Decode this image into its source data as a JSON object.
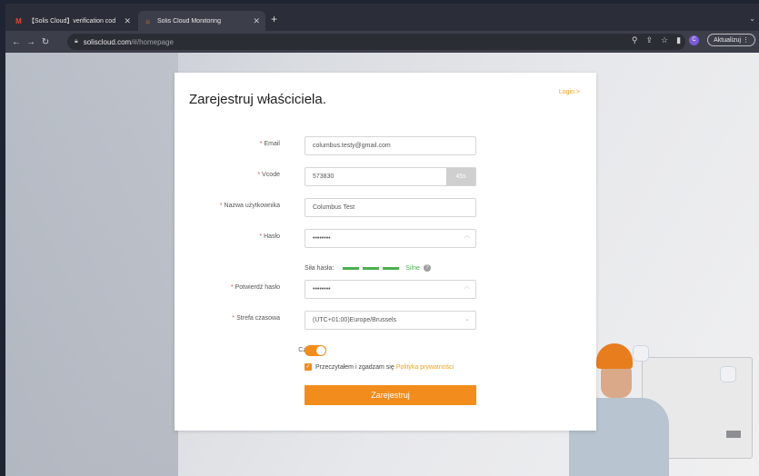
{
  "browser": {
    "tabs": [
      {
        "label": "【Solis Cloud】verification cod",
        "icon": "gmail-icon",
        "active": false
      },
      {
        "label": "Solis Cloud Monitoring",
        "icon": "solis-icon",
        "active": true
      }
    ],
    "url_host": "soliscloud.com",
    "url_path": "/#/homepage",
    "update_button": "Aktualizuj",
    "profile_initial": "C"
  },
  "form": {
    "title": "Zarejestruj właściciela.",
    "login_link": "Login >",
    "email": {
      "label": "Email",
      "value": "columbus.testy@gmail.com"
    },
    "vcode": {
      "label": "Vcode",
      "value": "573830",
      "countdown": "45s"
    },
    "username": {
      "label": "Nazwa użytkownika",
      "value": "Columbus Test"
    },
    "password": {
      "label": "Hasło",
      "value": "••••••••"
    },
    "strength": {
      "label": "Siła hasła:",
      "value": "Silne"
    },
    "confirm_password": {
      "label": "Potwierdź hasło",
      "value": "••••••••"
    },
    "timezone": {
      "label": "Strefa czasowa",
      "value": "(UTC+01:00)Europe/Brussels"
    },
    "dst": {
      "label": "Czas letni",
      "on": true
    },
    "agree": {
      "text": "Przeczytałem i zgadzam się",
      "link": "Polityka prywatności",
      "checked": true
    },
    "submit": "Zarejestruj",
    "required_mark": "*"
  },
  "colors": {
    "accent": "#f28c1c",
    "link": "#f0a11e",
    "strength": "#4caf50",
    "required": "#e5534b"
  }
}
